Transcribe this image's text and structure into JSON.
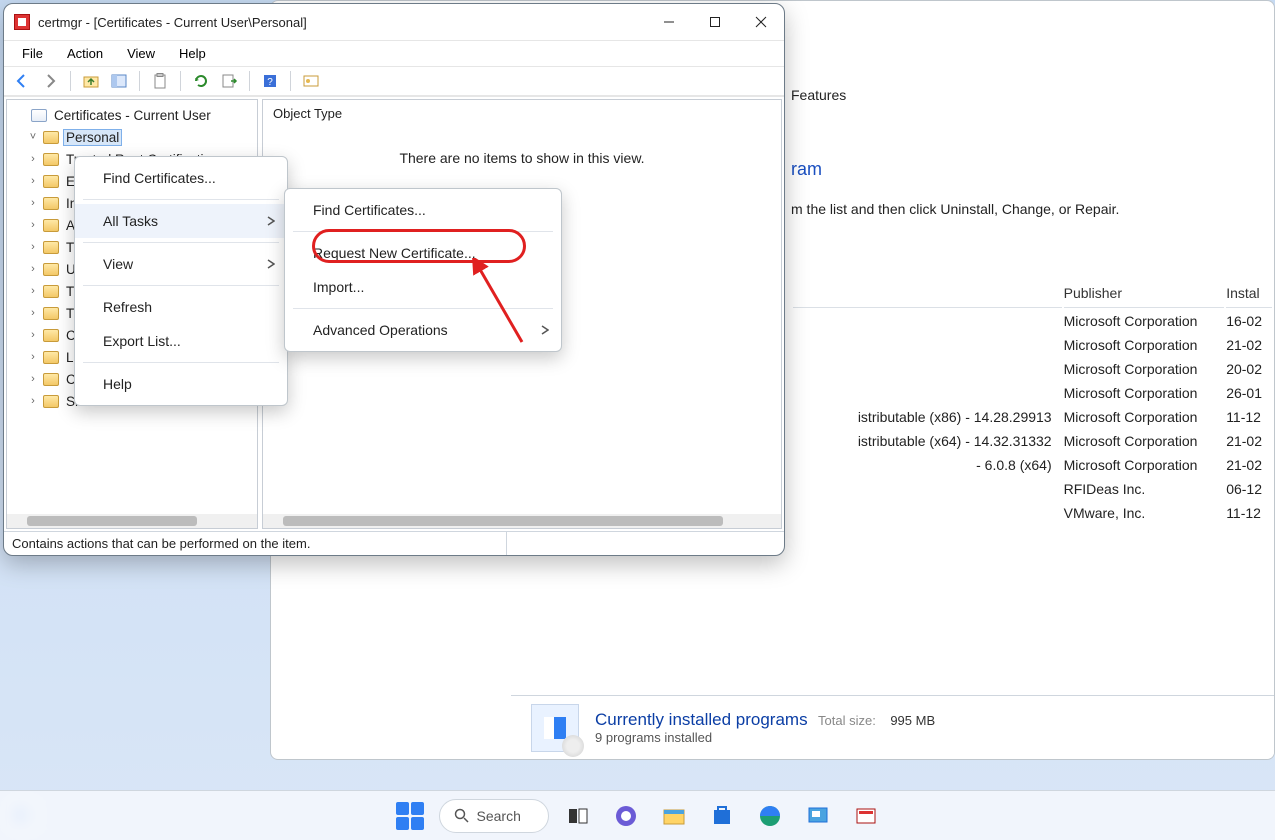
{
  "window": {
    "title": "certmgr - [Certificates - Current User\\Personal]",
    "menubar": [
      "File",
      "Action",
      "View",
      "Help"
    ]
  },
  "tree": {
    "root_label": "Certificates - Current User",
    "nodes": [
      "Personal",
      "Trusted Root Certification",
      "Enterprise Trust",
      "Intermediate Certification",
      "Active Directory User Obje",
      "Trusted Publishers",
      "Untrusted Certificates",
      "Third-Party Root Certificat",
      "Trusted People",
      "Client Authentication Issu",
      "Local NonRemovable Certifica",
      "Certificate Enrollment Reques",
      "Smart Card Trusted Roots"
    ]
  },
  "list": {
    "header": "Object Type",
    "empty_text": "There are no items to show in this view."
  },
  "status": "Contains actions that can be performed on the item.",
  "ctx_main": {
    "find": "Find Certificates...",
    "all_tasks": "All Tasks",
    "view": "View",
    "refresh": "Refresh",
    "export": "Export List...",
    "help": "Help"
  },
  "ctx_sub": {
    "find": "Find Certificates...",
    "request": "Request New Certificate...",
    "import": "Import...",
    "adv": "Advanced Operations"
  },
  "bg": {
    "features_label": "Features",
    "heading_suffix": "ram",
    "help_suffix": "m the list and then click Uninstall, Change, or Repair.",
    "col_publisher": "Publisher",
    "col_installed": "Instal",
    "rows": [
      {
        "name": "",
        "pub": "Microsoft Corporation",
        "date": "16-02"
      },
      {
        "name": "",
        "pub": "Microsoft Corporation",
        "date": "21-02"
      },
      {
        "name": "",
        "pub": "Microsoft Corporation",
        "date": "20-02"
      },
      {
        "name": "",
        "pub": "Microsoft Corporation",
        "date": "26-01"
      },
      {
        "name": "istributable (x86) - 14.28.29913",
        "pub": "Microsoft Corporation",
        "date": "11-12"
      },
      {
        "name": "istributable (x64) - 14.32.31332",
        "pub": "Microsoft Corporation",
        "date": "21-02"
      },
      {
        "name": " - 6.0.8 (x64)",
        "pub": "Microsoft Corporation",
        "date": "21-02"
      },
      {
        "name": "",
        "pub": "RFIDeas Inc.",
        "date": "06-12"
      },
      {
        "name": "",
        "pub": "VMware, Inc.",
        "date": "11-12"
      }
    ],
    "summary_title": "Currently installed programs",
    "summary_sub": "9 programs installed",
    "total_label": "Total size:",
    "total_value": "995 MB"
  },
  "taskbar": {
    "search": "Search"
  }
}
